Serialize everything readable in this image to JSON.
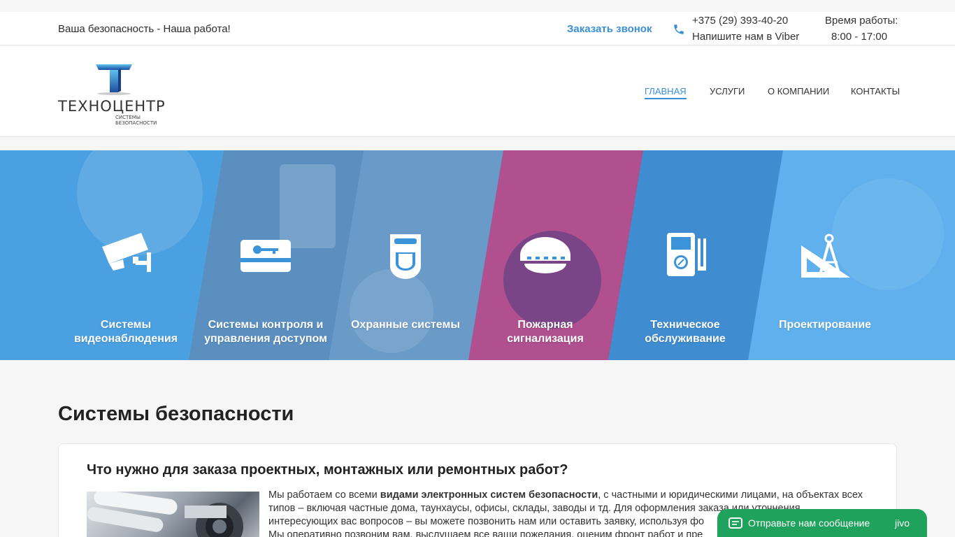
{
  "topbar": {
    "tagline": "Ваша безопасность - Наша работа!",
    "callback_label": "Заказать звонок",
    "phone": "+375 (29) 393-40-20",
    "viber": "Напишите нам в Viber",
    "hours_label": "Время работы:",
    "hours_value": "8:00 - 17:00"
  },
  "logo": {
    "name": "ТЕХНОЦЕНТР",
    "subtitle": "СИСТЕМЫ БЕЗОПАСНОСТИ"
  },
  "nav": {
    "items": [
      {
        "label": "ГЛАВНАЯ",
        "active": true
      },
      {
        "label": "УСЛУГИ",
        "active": false
      },
      {
        "label": "О КОМПАНИИ",
        "active": false
      },
      {
        "label": "КОНТАКТЫ",
        "active": false
      }
    ]
  },
  "services": [
    {
      "line1": "Системы",
      "line2": "видеонаблюдения",
      "icon": "cctv-camera-icon"
    },
    {
      "line1": "Системы контроля и",
      "line2": "управления доступом",
      "icon": "key-card-icon"
    },
    {
      "line1": "Охранные системы",
      "line2": "",
      "icon": "motion-sensor-icon"
    },
    {
      "line1": "Пожарная",
      "line2": "сигнализация",
      "icon": "smoke-detector-icon"
    },
    {
      "line1": "Техническое",
      "line2": "обслуживание",
      "icon": "multimeter-icon"
    },
    {
      "line1": "Проектирование",
      "line2": "",
      "icon": "drafting-compass-icon"
    }
  ],
  "section": {
    "title": "Системы безопасности"
  },
  "card": {
    "title": "Что нужно для заказа проектных, монтажных или ремонтных работ?",
    "text_pre": "Мы работаем со всеми ",
    "text_bold": "видами электронных систем безопасности",
    "text_post": ", с частными и юридическими лицами, на объектах всех типов – включая частные дома, таунхаусы, офисы, склады, заводы и тд. Для оформления заказа или уточнения интересующих вас вопросов – вы можете позвонить нам или оставить заявку, используя фо",
    "text_line4": "Мы оперативно позвоним вам, выслушаем все ваши пожелания, оценим фронт работ и пре"
  },
  "chat": {
    "label": "Отправьте нам сообщение",
    "brand": "jivo"
  },
  "colors": {
    "accent": "#3a8fd6",
    "hero_blue": "#3b94d9",
    "fire_pink": "#c04a8a",
    "chat_green": "#1fa25b"
  }
}
